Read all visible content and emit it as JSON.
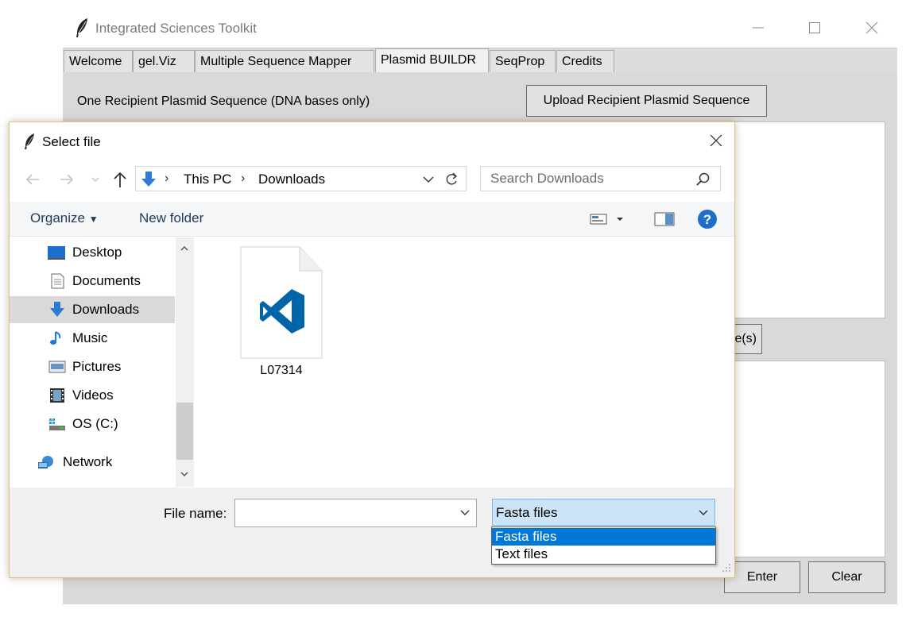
{
  "app": {
    "title": "Integrated Sciences Toolkit",
    "tabs": [
      {
        "label": "Welcome"
      },
      {
        "label": "gel.Viz"
      },
      {
        "label": "Multiple Sequence Mapper"
      },
      {
        "label": "Plasmid BUILDR",
        "active": true
      },
      {
        "label": "SeqProp"
      },
      {
        "label": "Credits"
      }
    ],
    "content": {
      "recipient_label": "One Recipient Plasmid Sequence (DNA bases only)",
      "upload_button": "Upload Recipient Plasmid Sequence",
      "partial_button": "e(s)",
      "enter_button": "Enter",
      "clear_button": "Clear"
    }
  },
  "dialog": {
    "title": "Select file",
    "breadcrumb": [
      "This PC",
      "Downloads"
    ],
    "search_placeholder": "Search Downloads",
    "toolbar": {
      "organize": "Organize",
      "new_folder": "New folder"
    },
    "nav_items": [
      {
        "label": "Desktop",
        "icon": "desktop-icon"
      },
      {
        "label": "Documents",
        "icon": "documents-icon"
      },
      {
        "label": "Downloads",
        "icon": "downloads-icon",
        "selected": true
      },
      {
        "label": "Music",
        "icon": "music-icon"
      },
      {
        "label": "Pictures",
        "icon": "pictures-icon"
      },
      {
        "label": "Videos",
        "icon": "videos-icon"
      },
      {
        "label": "OS (C:)",
        "icon": "drive-icon"
      },
      {
        "label": "Network",
        "icon": "network-icon"
      }
    ],
    "files": [
      {
        "name": "L07314",
        "icon": "vscode-file-icon"
      }
    ],
    "file_name_label": "File name:",
    "file_name_value": "",
    "file_type_selected": "Fasta files",
    "file_type_options": [
      "Fasta files",
      "Text files"
    ],
    "file_type_highlighted": "Fasta files"
  },
  "colors": {
    "accent": "#0078d7",
    "vscode_blue": "#0065a9",
    "folder_blue": "#2e7bd6",
    "selected_bg": "#d9d9d9",
    "dialog_border": "#e8c267"
  }
}
